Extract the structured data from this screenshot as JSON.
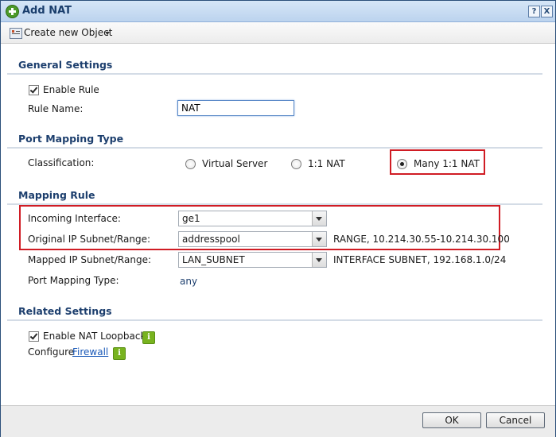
{
  "window": {
    "title": "Add NAT",
    "help_label": "?",
    "close_label": "X"
  },
  "toolbar": {
    "create_label": "Create new Object"
  },
  "general": {
    "heading": "General Settings",
    "enable_rule_label": "Enable Rule",
    "rule_name_label": "Rule Name:",
    "rule_name_value": "NAT"
  },
  "port_mapping_type": {
    "heading": "Port Mapping Type",
    "classification_label": "Classification:",
    "options": [
      "Virtual Server",
      "1:1 NAT",
      "Many 1:1 NAT"
    ],
    "selected": "Many 1:1 NAT"
  },
  "mapping_rule": {
    "heading": "Mapping Rule",
    "incoming_label": "Incoming Interface:",
    "incoming_value": "ge1",
    "original_label": "Original IP Subnet/Range:",
    "original_value": "addresspool",
    "original_info": "RANGE, 10.214.30.55-10.214.30.100",
    "mapped_label": "Mapped IP Subnet/Range:",
    "mapped_value": "LAN_SUBNET",
    "mapped_info": "INTERFACE SUBNET, 192.168.1.0/24",
    "port_mapping_label": "Port Mapping Type:",
    "port_mapping_value": "any"
  },
  "related": {
    "heading": "Related Settings",
    "loopback_label": "Enable NAT Loopback",
    "configure_label": "Configure",
    "firewall_link": "Firewall",
    "info_glyph": "i"
  },
  "footer": {
    "ok_label": "OK",
    "cancel_label": "Cancel"
  },
  "colors": {
    "highlight": "#d01c24",
    "heading": "#1d3f6e",
    "link": "#1a59b8",
    "info": "#78b31f"
  }
}
